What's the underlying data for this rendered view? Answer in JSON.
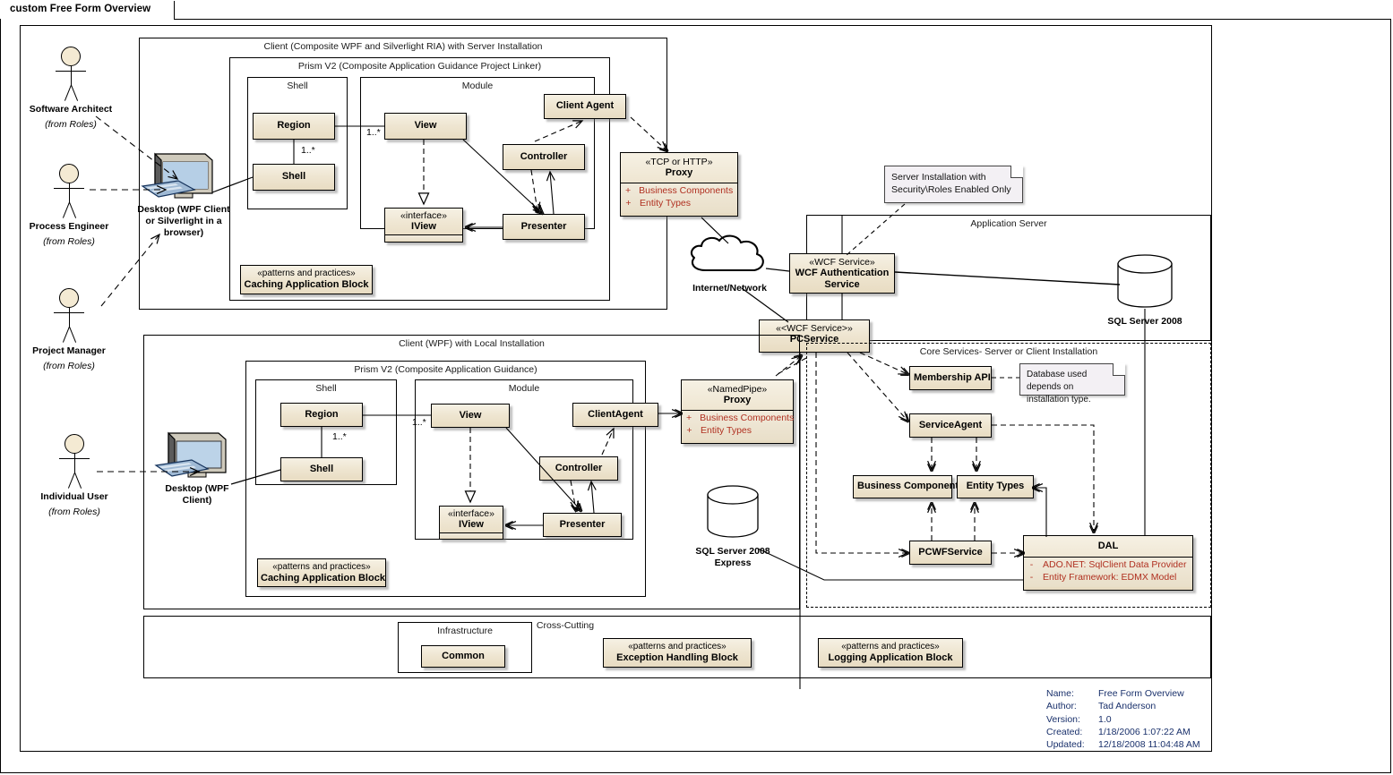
{
  "window": {
    "tab_label": "custom Free Form Overview"
  },
  "actors": [
    {
      "name": "Software Architect",
      "from": "(from Roles)"
    },
    {
      "name": "Process Engineer",
      "from": "(from Roles)"
    },
    {
      "name": "Project Manager",
      "from": "(from Roles)"
    },
    {
      "name": "Individual User",
      "from": "(from Roles)"
    }
  ],
  "nodes": {
    "desktop_ria": "Desktop (WPF Client or Silverlight in a browser)",
    "desktop_wpf": "Desktop (WPF Client)",
    "internet": "Internet/Network",
    "sql_server_2008": "SQL Server 2008",
    "sql_server_express": "SQL Server 2008 Express"
  },
  "client_ria": {
    "title": "Client (Composite WPF and Silverlight RIA) with Server Installation",
    "prism": {
      "title": "Prism V2 (Composite Application Guidance Project Linker)",
      "shell_group": "Shell",
      "module_group": "Module",
      "region": "Region",
      "shell": "Shell",
      "multiplicity_shell": "1..*",
      "multiplicity_view": "1..*",
      "view": "View",
      "iview_stereotype": "«interface»",
      "iview": "IView",
      "controller": "Controller",
      "presenter": "Presenter",
      "client_agent": "Client Agent"
    },
    "caching_stereotype": "«patterns and practices»",
    "caching": "Caching Application Block"
  },
  "client_wpf": {
    "title": "Client (WPF) with Local Installation",
    "prism": {
      "title": "Prism V2 (Composite Application Guidance)",
      "shell_group": "Shell",
      "module_group": "Module",
      "region": "Region",
      "shell": "Shell",
      "multiplicity_shell": "1..*",
      "multiplicity_view": "1..*",
      "view": "View",
      "iview_stereotype": "«interface»",
      "iview": "IView",
      "controller": "Controller",
      "presenter": "Presenter",
      "client_agent": "ClientAgent"
    },
    "caching_stereotype": "«patterns and practices»",
    "caching": "Caching Application Block"
  },
  "proxies": {
    "tcp_http": {
      "stereotype": "«TCP or HTTP»",
      "name": "Proxy",
      "features": [
        {
          "visibility": "+",
          "label": "Business Components"
        },
        {
          "visibility": "+",
          "label": "Entity Types"
        }
      ]
    },
    "named_pipe": {
      "stereotype": "«NamedPipe»",
      "name": "Proxy",
      "features": [
        {
          "visibility": "+",
          "label": "Business Components"
        },
        {
          "visibility": "+",
          "label": "Entity Types"
        }
      ]
    }
  },
  "app_server": {
    "title": "Application Server",
    "auth_service_stereotype": "«WCF Service»",
    "auth_service": "WCF Authentication Service",
    "pc_service_stereotype": "«<WCF Service>»",
    "pc_service": "PCService",
    "note_server_install": "Server Installation with Security\\Roles Enabled Only"
  },
  "core_services": {
    "title": "Core Services- Server or Client Installation",
    "membership_api": "Membership API",
    "service_agent": "ServiceAgent",
    "business_component": "Business Component",
    "entity_types": "Entity Types",
    "pcwf_service": "PCWFService",
    "dal": {
      "name": "DAL",
      "features": [
        {
          "visibility": "-",
          "label": "ADO.NET:  SqlClient Data Provider"
        },
        {
          "visibility": "-",
          "label": "Entity Framework:  EDMX Model"
        }
      ]
    },
    "note_database": "Database used depends on installation type."
  },
  "cross_cutting": {
    "title": "Cross-Cutting",
    "infrastructure_title": "Infrastructure",
    "common": "Common",
    "exception_stereotype": "«patterns and practices»",
    "exception": "Exception Handling Block",
    "logging_stereotype": "«patterns and practices»",
    "logging": "Logging Application Block"
  },
  "metadata": {
    "rows": [
      {
        "key": "Name:",
        "value": "Free Form Overview"
      },
      {
        "key": "Author:",
        "value": "Tad Anderson"
      },
      {
        "key": "Version:",
        "value": "1.0"
      },
      {
        "key": "Created:",
        "value": "1/18/2006 1:07:22 AM"
      },
      {
        "key": "Updated:",
        "value": "12/18/2008 11:04:48 AM"
      }
    ]
  },
  "colors": {
    "class_fill": "#efe6d2",
    "class_border": "#000000",
    "feature_text": "#b03020",
    "note_fill": "#f3f0f4",
    "metadata_text": "#19306b"
  }
}
